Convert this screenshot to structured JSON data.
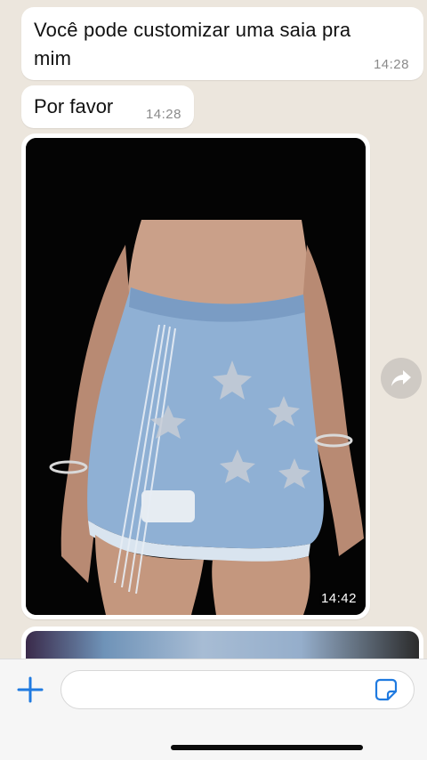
{
  "messages": [
    {
      "text": "Você pode customizar uma saia pra mim",
      "time": "14:28"
    },
    {
      "text": "Por favor",
      "time": "14:28"
    }
  ],
  "media_message": {
    "time": "14:42"
  },
  "icons": {
    "forward": "forward-arrow-icon",
    "attach": "plus-icon",
    "sticker": "sticker-icon"
  },
  "composer": {
    "value": "",
    "placeholder": ""
  },
  "colors": {
    "chat_background": "#ece6dd",
    "bubble": "#ffffff",
    "accent": "#1f7ae0",
    "timestamp": "#8a8a8a"
  }
}
